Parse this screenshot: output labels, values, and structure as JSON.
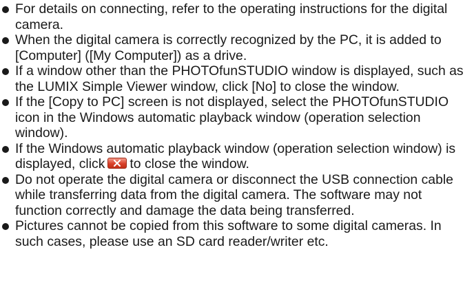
{
  "notes": [
    {
      "text": "For details on connecting, refer to the operating instructions for the digital camera."
    },
    {
      "text": "When the digital camera is correctly recognized by the PC, it is added to [Computer] ([My Computer]) as a drive."
    },
    {
      "text": "If a window other than the PHOTOfunSTUDIO window is displayed, such as the LUMIX Simple Viewer window, click [No] to close the window."
    },
    {
      "text": "If the [Copy to PC] screen is not displayed, select the PHOTOfunSTUDIO icon in the Windows automatic playback window (operation selection window)."
    },
    {
      "text_before": "If the Windows automatic playback window (operation selection window) is displayed, click",
      "icon": "window-close-button-icon",
      "text_after": "to close the window."
    },
    {
      "text": "Do not operate the digital camera or disconnect the USB connection cable while transferring data from the digital camera. The software may not function correctly and damage the data being transferred."
    },
    {
      "text": "Pictures cannot be copied from this software to some digital cameras. In such cases, please use an SD card reader/writer etc."
    }
  ],
  "colors": {
    "text": "#1a1a1a",
    "close_button": "#d9402a"
  }
}
